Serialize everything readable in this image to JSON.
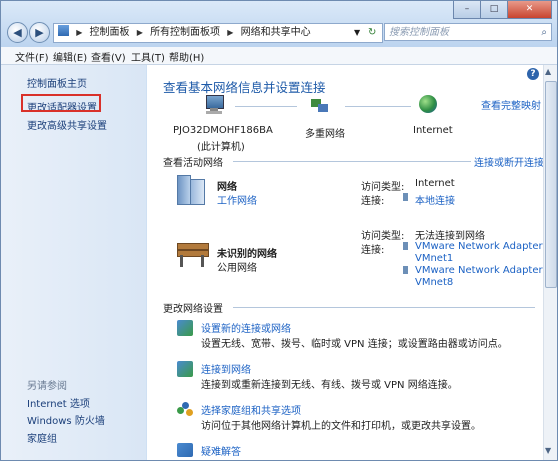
{
  "address": {
    "segments": [
      "控制面板",
      "所有控制面板项",
      "网络和共享中心"
    ],
    "search_placeholder": "搜索控制面板"
  },
  "menu": [
    "文件(F)",
    "编辑(E)",
    "查看(V)",
    "工具(T)",
    "帮助(H)"
  ],
  "sidebar": {
    "items": [
      {
        "label": "控制面板主页"
      },
      {
        "label": "更改适配器设置"
      },
      {
        "label": "更改高级共享设置"
      }
    ],
    "see_also_label": "另请参阅",
    "see_also": [
      {
        "label": "Internet 选项"
      },
      {
        "label": "Windows 防火墙"
      },
      {
        "label": "家庭组"
      }
    ]
  },
  "main": {
    "title": "查看基本网络信息并设置连接",
    "view_full_map": "查看完整映射",
    "map": {
      "computer": "PJO32DMOHF186BA",
      "computer_sub": "(此计算机)",
      "multi": "多重网络",
      "internet": "Internet"
    },
    "active_label": "查看活动网络",
    "connect_link": "连接或断开连接",
    "net1": {
      "name": "网络",
      "type": "工作网络",
      "access_label": "访问类型:",
      "access_value": "Internet",
      "conn_label": "连接:",
      "conn_value": "本地连接"
    },
    "net2": {
      "name": "未识别的网络",
      "type": "公用网络",
      "access_label": "访问类型:",
      "access_value": "无法连接到网络",
      "conn_label": "连接:",
      "conn_lines": [
        "VMware Network Adapter",
        "VMnet1",
        "VMware Network Adapter",
        "VMnet8"
      ]
    },
    "change_label": "更改网络设置",
    "tasks": [
      {
        "title": "设置新的连接或网络",
        "desc": "设置无线、宽带、拨号、临时或 VPN 连接；或设置路由器或访问点。"
      },
      {
        "title": "连接到网络",
        "desc": "连接到或重新连接到无线、有线、拨号或 VPN 网络连接。"
      },
      {
        "title": "选择家庭组和共享选项",
        "desc": "访问位于其他网络计算机上的文件和打印机，或更改共享设置。"
      },
      {
        "title": "疑难解答",
        "desc": ""
      }
    ]
  },
  "colors": {
    "accent": "#1e5aa8",
    "link": "#1c62c4",
    "highlight": "#d9312a"
  }
}
